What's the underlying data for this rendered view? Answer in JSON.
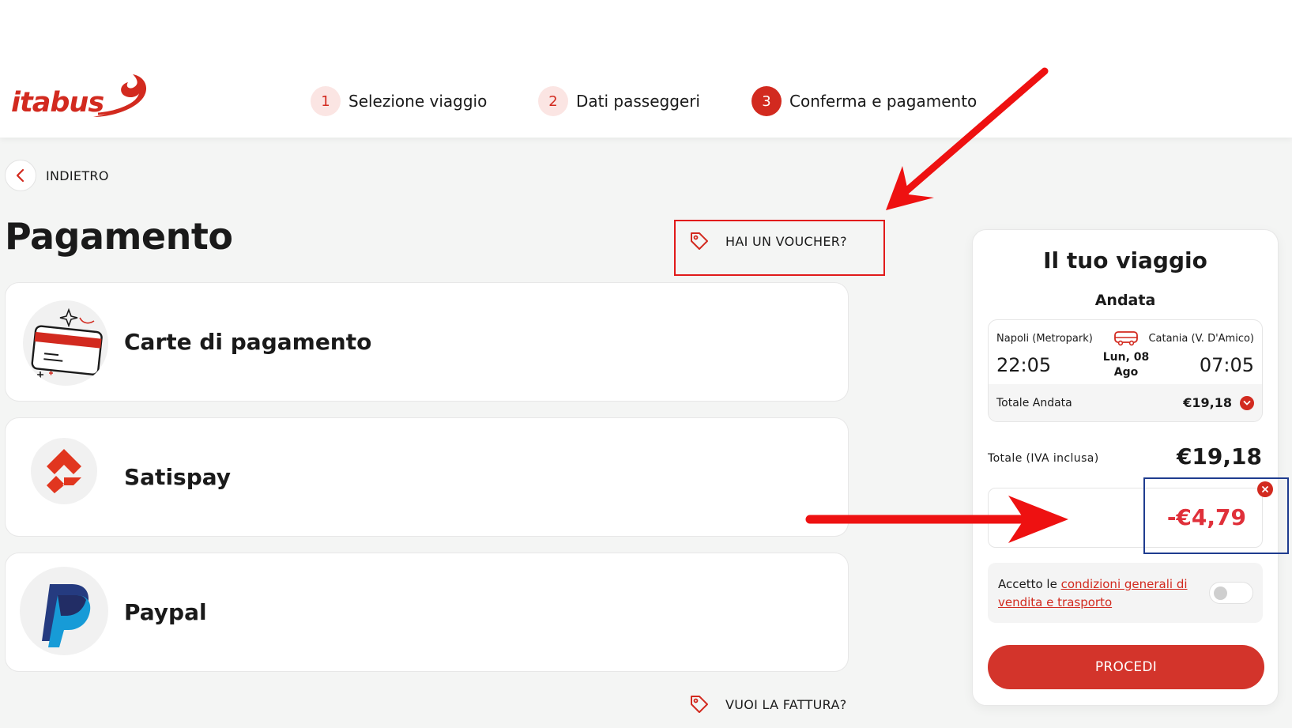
{
  "brand": {
    "name": "itabus",
    "color": "#d22a1f"
  },
  "steps": [
    {
      "number": "1",
      "label": "Selezione viaggio",
      "active": false
    },
    {
      "number": "2",
      "label": "Dati passeggeri",
      "active": false
    },
    {
      "number": "3",
      "label": "Conferma e pagamento",
      "active": true
    }
  ],
  "nav": {
    "back_label": "INDIETRO",
    "back_icon": "chevron-left-icon"
  },
  "page": {
    "title": "Pagamento"
  },
  "voucher": {
    "label": "HAI UN VOUCHER?",
    "icon": "tag-icon"
  },
  "payment_methods": [
    {
      "label": "Carte di pagamento",
      "icon": "credit-card-icon"
    },
    {
      "label": "Satispay",
      "icon": "satispay-icon"
    },
    {
      "label": "Paypal",
      "icon": "paypal-icon"
    }
  ],
  "invoice": {
    "label": "VUOI LA FATTURA?",
    "icon": "tag-icon"
  },
  "summary": {
    "title": "Il tuo viaggio",
    "leg_title": "Andata",
    "from": "Napoli (Metropark)",
    "to": "Catania (V. D'Amico)",
    "departure_time": "22:05",
    "arrival_time": "07:05",
    "date_line1": "Lun, 08",
    "date_line2": "Ago",
    "leg_total_label": "Totale Andata",
    "leg_total_value": "€19,18",
    "total_label": "Totale (IVA inclusa)",
    "total_value": "€19,18",
    "discount_value": "-€4,79",
    "terms_prefix": "Accetto le ",
    "terms_link": "condizioni generali di vendita e trasporto",
    "terms_accepted": false,
    "proceed_label": "PROCEDI"
  },
  "colors": {
    "accent": "#d22a1f",
    "discount": "#e0303a",
    "annotation_red": "#e11a1a",
    "annotation_blue": "#1f3c8f"
  }
}
